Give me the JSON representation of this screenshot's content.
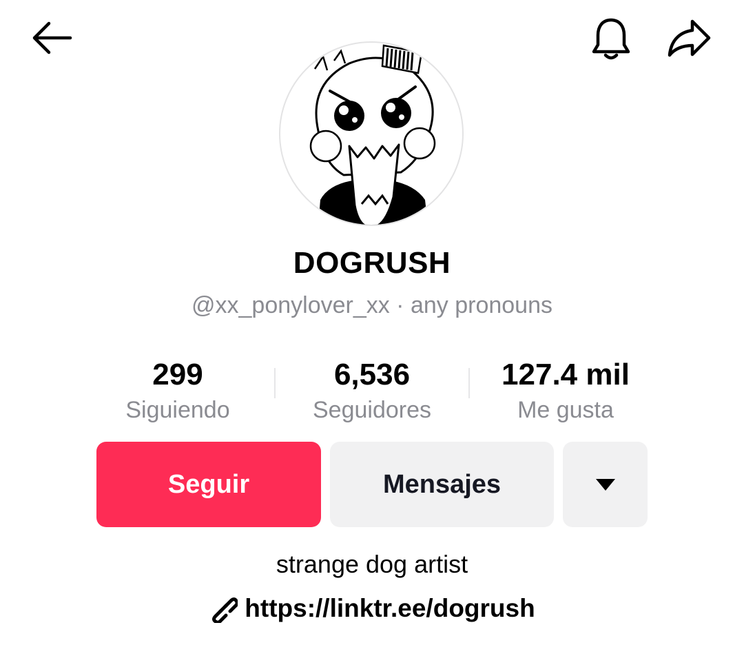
{
  "header": {
    "back_icon": "arrow-left-icon",
    "notification_icon": "bell-icon",
    "share_icon": "share-arrow-icon"
  },
  "profile": {
    "avatar_icon": "cartoon-dog-avatar",
    "display_name": "DOGRUSH",
    "handle_line": "@xx_ponylover_xx · any pronouns"
  },
  "stats": [
    {
      "value": "299",
      "label": "Siguiendo"
    },
    {
      "value": "6,536",
      "label": "Seguidores"
    },
    {
      "value": "127.4 mil",
      "label": "Me gusta"
    }
  ],
  "actions": {
    "follow_label": "Seguir",
    "message_label": "Mensajes",
    "more_icon": "caret-down-icon"
  },
  "bio": {
    "text": "strange dog artist",
    "link_icon": "link-icon",
    "link": "https://linktr.ee/dogrush"
  },
  "colors": {
    "accent": "#fe2c55",
    "secondary_button": "#f1f1f2",
    "muted_text": "#8a8b91"
  }
}
